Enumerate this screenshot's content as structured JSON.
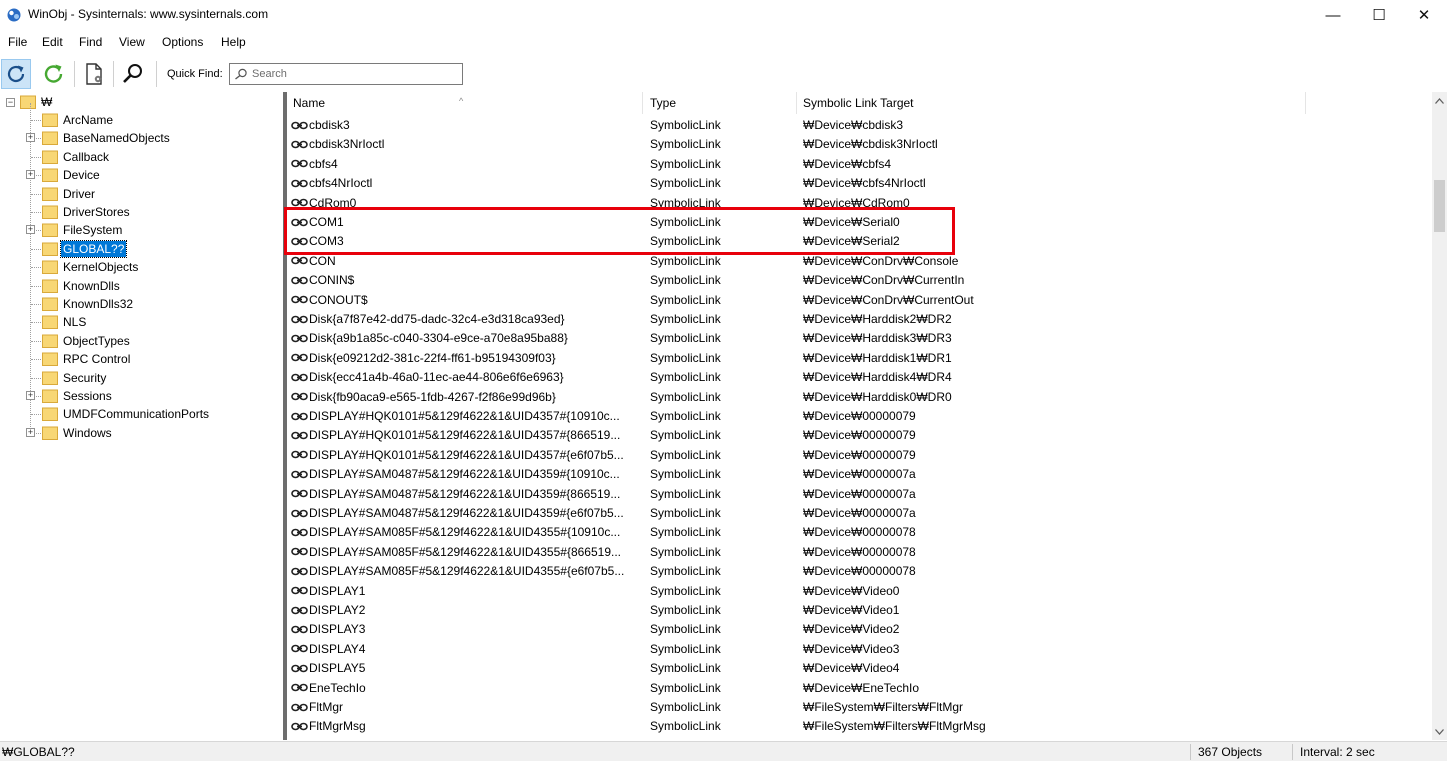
{
  "window": {
    "title": "WinObj - Sysinternals: www.sysinternals.com",
    "minimize": "—",
    "maximize": "☐",
    "close": "✕"
  },
  "menu": [
    "File",
    "Edit",
    "Find",
    "View",
    "Options",
    "Help"
  ],
  "toolbar": {
    "quick_find_label": "Quick Find:",
    "search_placeholder": "Search"
  },
  "tree": {
    "root": "₩",
    "items": [
      {
        "label": "ArcName",
        "expandable": false
      },
      {
        "label": "BaseNamedObjects",
        "expandable": true
      },
      {
        "label": "Callback",
        "expandable": false
      },
      {
        "label": "Device",
        "expandable": true
      },
      {
        "label": "Driver",
        "expandable": false
      },
      {
        "label": "DriverStores",
        "expandable": false
      },
      {
        "label": "FileSystem",
        "expandable": true
      },
      {
        "label": "GLOBAL??",
        "expandable": false,
        "selected": true
      },
      {
        "label": "KernelObjects",
        "expandable": false
      },
      {
        "label": "KnownDlls",
        "expandable": false
      },
      {
        "label": "KnownDlls32",
        "expandable": false
      },
      {
        "label": "NLS",
        "expandable": false
      },
      {
        "label": "ObjectTypes",
        "expandable": false
      },
      {
        "label": "RPC Control",
        "expandable": false
      },
      {
        "label": "Security",
        "expandable": false
      },
      {
        "label": "Sessions",
        "expandable": true
      },
      {
        "label": "UMDFCommunicationPorts",
        "expandable": false
      },
      {
        "label": "Windows",
        "expandable": true
      }
    ]
  },
  "list": {
    "columns": [
      "Name",
      "Type",
      "Symbolic Link Target"
    ],
    "rows": [
      {
        "name": "cbdisk3",
        "type": "SymbolicLink",
        "target": "₩Device₩cbdisk3"
      },
      {
        "name": "cbdisk3NrIoctl",
        "type": "SymbolicLink",
        "target": "₩Device₩cbdisk3NrIoctl"
      },
      {
        "name": "cbfs4",
        "type": "SymbolicLink",
        "target": "₩Device₩cbfs4"
      },
      {
        "name": "cbfs4NrIoctl",
        "type": "SymbolicLink",
        "target": "₩Device₩cbfs4NrIoctl"
      },
      {
        "name": "CdRom0",
        "type": "SymbolicLink",
        "target": "₩Device₩CdRom0"
      },
      {
        "name": "COM1",
        "type": "SymbolicLink",
        "target": "₩Device₩Serial0"
      },
      {
        "name": "COM3",
        "type": "SymbolicLink",
        "target": "₩Device₩Serial2"
      },
      {
        "name": "CON",
        "type": "SymbolicLink",
        "target": "₩Device₩ConDrv₩Console"
      },
      {
        "name": "CONIN$",
        "type": "SymbolicLink",
        "target": "₩Device₩ConDrv₩CurrentIn"
      },
      {
        "name": "CONOUT$",
        "type": "SymbolicLink",
        "target": "₩Device₩ConDrv₩CurrentOut"
      },
      {
        "name": "Disk{a7f87e42-dd75-dadc-32c4-e3d318ca93ed}",
        "type": "SymbolicLink",
        "target": "₩Device₩Harddisk2₩DR2"
      },
      {
        "name": "Disk{a9b1a85c-c040-3304-e9ce-a70e8a95ba88}",
        "type": "SymbolicLink",
        "target": "₩Device₩Harddisk3₩DR3"
      },
      {
        "name": "Disk{e09212d2-381c-22f4-ff61-b95194309f03}",
        "type": "SymbolicLink",
        "target": "₩Device₩Harddisk1₩DR1"
      },
      {
        "name": "Disk{ecc41a4b-46a0-11ec-ae44-806e6f6e6963}",
        "type": "SymbolicLink",
        "target": "₩Device₩Harddisk4₩DR4"
      },
      {
        "name": "Disk{fb90aca9-e565-1fdb-4267-f2f86e99d96b}",
        "type": "SymbolicLink",
        "target": "₩Device₩Harddisk0₩DR0"
      },
      {
        "name": "DISPLAY#HQK0101#5&129f4622&1&UID4357#{10910c...",
        "type": "SymbolicLink",
        "target": "₩Device₩00000079"
      },
      {
        "name": "DISPLAY#HQK0101#5&129f4622&1&UID4357#{866519...",
        "type": "SymbolicLink",
        "target": "₩Device₩00000079"
      },
      {
        "name": "DISPLAY#HQK0101#5&129f4622&1&UID4357#{e6f07b5...",
        "type": "SymbolicLink",
        "target": "₩Device₩00000079"
      },
      {
        "name": "DISPLAY#SAM0487#5&129f4622&1&UID4359#{10910c...",
        "type": "SymbolicLink",
        "target": "₩Device₩0000007a"
      },
      {
        "name": "DISPLAY#SAM0487#5&129f4622&1&UID4359#{866519...",
        "type": "SymbolicLink",
        "target": "₩Device₩0000007a"
      },
      {
        "name": "DISPLAY#SAM0487#5&129f4622&1&UID4359#{e6f07b5...",
        "type": "SymbolicLink",
        "target": "₩Device₩0000007a"
      },
      {
        "name": "DISPLAY#SAM085F#5&129f4622&1&UID4355#{10910c...",
        "type": "SymbolicLink",
        "target": "₩Device₩00000078"
      },
      {
        "name": "DISPLAY#SAM085F#5&129f4622&1&UID4355#{866519...",
        "type": "SymbolicLink",
        "target": "₩Device₩00000078"
      },
      {
        "name": "DISPLAY#SAM085F#5&129f4622&1&UID4355#{e6f07b5...",
        "type": "SymbolicLink",
        "target": "₩Device₩00000078"
      },
      {
        "name": "DISPLAY1",
        "type": "SymbolicLink",
        "target": "₩Device₩Video0"
      },
      {
        "name": "DISPLAY2",
        "type": "SymbolicLink",
        "target": "₩Device₩Video1"
      },
      {
        "name": "DISPLAY3",
        "type": "SymbolicLink",
        "target": "₩Device₩Video2"
      },
      {
        "name": "DISPLAY4",
        "type": "SymbolicLink",
        "target": "₩Device₩Video3"
      },
      {
        "name": "DISPLAY5",
        "type": "SymbolicLink",
        "target": "₩Device₩Video4"
      },
      {
        "name": "EneTechIo",
        "type": "SymbolicLink",
        "target": "₩Device₩EneTechIo"
      },
      {
        "name": "FltMgr",
        "type": "SymbolicLink",
        "target": "₩FileSystem₩Filters₩FltMgr"
      },
      {
        "name": "FltMgrMsg",
        "type": "SymbolicLink",
        "target": "₩FileSystem₩Filters₩FltMgrMsg"
      }
    ]
  },
  "status": {
    "path": "₩GLOBAL??",
    "count": "367 Objects",
    "interval": "Interval: 2 sec"
  },
  "colors": {
    "highlight_box": "#e8000b",
    "selection": "#0078d7",
    "folder": "#f8d775"
  },
  "icons": {
    "app": "winobj-app-icon",
    "refresh": "refresh-icon",
    "auto_refresh": "auto-refresh-icon",
    "properties": "properties-icon",
    "find": "find-icon",
    "folder": "folder-icon",
    "symlink": "symlink-icon"
  }
}
